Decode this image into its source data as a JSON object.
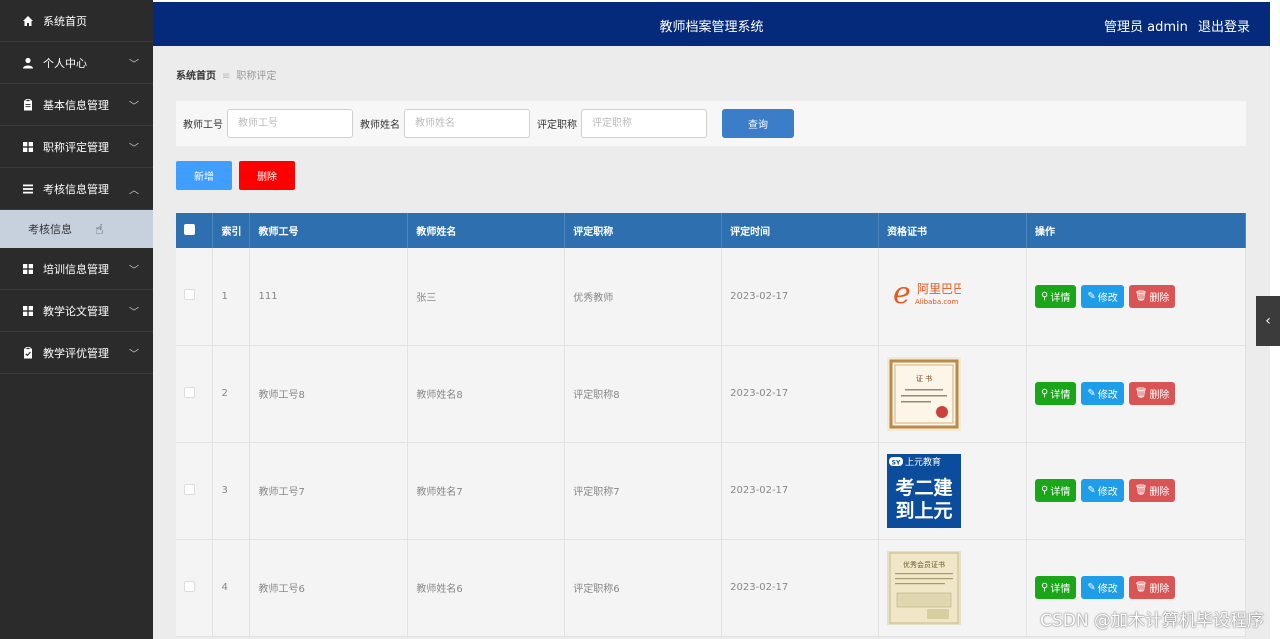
{
  "topbar": {
    "title": "教师档案管理系统",
    "user_label": "管理员 admin",
    "logout": "退出登录"
  },
  "sidebar": {
    "items": [
      {
        "label": "系统首页",
        "icon": "home-icon"
      },
      {
        "label": "个人中心",
        "icon": "user-icon"
      },
      {
        "label": "基本信息管理",
        "icon": "clipboard-icon"
      },
      {
        "label": "职称评定管理",
        "icon": "grid-icon"
      },
      {
        "label": "考核信息管理",
        "icon": "list-icon"
      },
      {
        "label": "培训信息管理",
        "icon": "grid-icon"
      },
      {
        "label": "教学论文管理",
        "icon": "grid-icon"
      },
      {
        "label": "教学评优管理",
        "icon": "clipboard-check-icon"
      }
    ],
    "sub_item": "考核信息"
  },
  "breadcrumb": {
    "home": "系统首页",
    "current": "职称评定"
  },
  "search": {
    "field1_label": "教师工号",
    "field1_placeholder": "教师工号",
    "field2_label": "教师姓名",
    "field2_placeholder": "教师姓名",
    "field3_label": "评定职称",
    "field3_placeholder": "评定职称",
    "query_button": "查询"
  },
  "actions": {
    "add": "新增",
    "delete": "删除"
  },
  "table": {
    "headers": [
      "索引",
      "教师工号",
      "教师姓名",
      "评定职称",
      "评定时间",
      "资格证书",
      "操作"
    ],
    "rows": [
      {
        "index": "1",
        "teacher_id": "111",
        "teacher_name": "张三",
        "title": "优秀教师",
        "date": "2023-02-17"
      },
      {
        "index": "2",
        "teacher_id": "教师工号8",
        "teacher_name": "教师姓名8",
        "title": "评定职称8",
        "date": "2023-02-17"
      },
      {
        "index": "3",
        "teacher_id": "教师工号7",
        "teacher_name": "教师姓名7",
        "title": "评定职称7",
        "date": "2023-02-17"
      },
      {
        "index": "4",
        "teacher_id": "教师工号6",
        "teacher_name": "教师姓名6",
        "title": "评定职称6",
        "date": "2023-02-17"
      }
    ],
    "op_labels": {
      "detail": "详情",
      "edit": "修改",
      "remove": "删除"
    },
    "cert_texts": {
      "alibaba_cn": "阿里巴巴",
      "alibaba_en": "Alibaba.com",
      "cert2_title": "证 书",
      "cert3_brand": "上元教育",
      "cert3_line1": "考二建",
      "cert3_line2": "到上元",
      "cert4_title": "优秀会员证书"
    }
  },
  "watermark": "CSDN @加木计算机毕设程序"
}
